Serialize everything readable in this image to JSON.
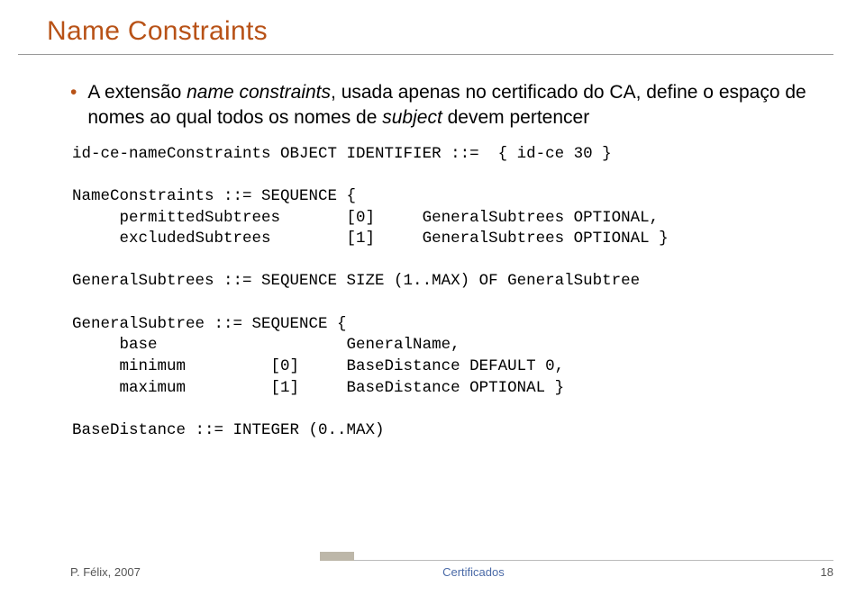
{
  "title": "Name Constraints",
  "bullet": {
    "text_prefix": "A extensão ",
    "italic1": "name constraints",
    "text_mid1": ", usada apenas no certificado do CA, define o espaço de nomes ao qual todos os nomes de ",
    "italic2": "subject",
    "text_mid2": " devem pertencer"
  },
  "code": "id-ce-nameConstraints OBJECT IDENTIFIER ::=  { id-ce 30 }\n\nNameConstraints ::= SEQUENCE {\n     permittedSubtrees       [0]     GeneralSubtrees OPTIONAL,\n     excludedSubtrees        [1]     GeneralSubtrees OPTIONAL }\n\nGeneralSubtrees ::= SEQUENCE SIZE (1..MAX) OF GeneralSubtree\n\nGeneralSubtree ::= SEQUENCE {\n     base                    GeneralName,\n     minimum         [0]     BaseDistance DEFAULT 0,\n     maximum         [1]     BaseDistance OPTIONAL }\n\nBaseDistance ::= INTEGER (0..MAX)",
  "footer": {
    "left": "P. Félix, 2007",
    "center": "Certificados",
    "right": "18"
  }
}
